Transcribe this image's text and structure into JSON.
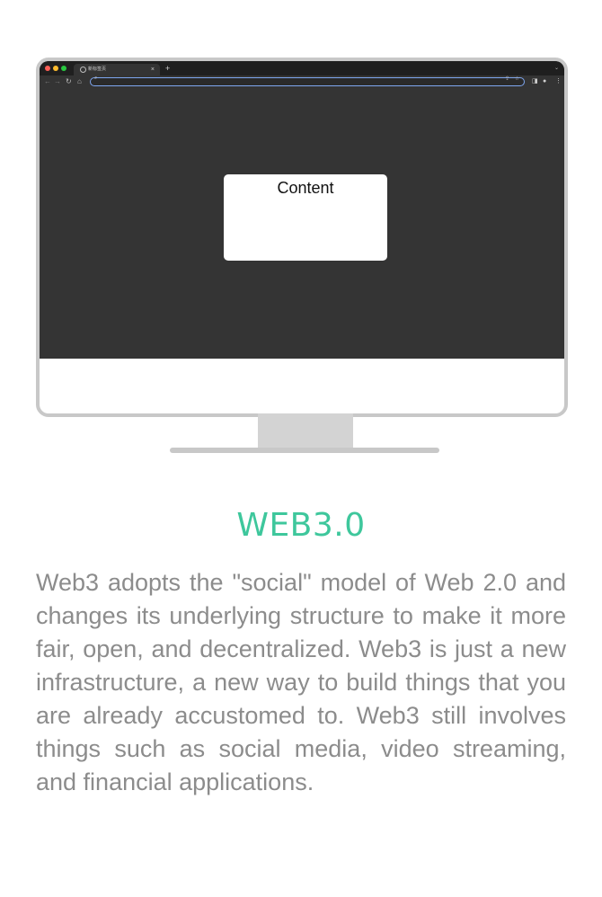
{
  "colors": {
    "accent": "#3ec79c",
    "body_text": "#8c8c8c",
    "screen": "#343434",
    "bezel": "#c8c8c8",
    "dot_red": "#ff5f57",
    "dot_yellow": "#febc2e",
    "dot_green": "#28c840"
  },
  "browser": {
    "tab_title": "新标签页",
    "tab_close": "×",
    "new_tab": "+",
    "tab_menu": "⌄",
    "icons": {
      "back": "arrow-left-icon",
      "forward": "arrow-right-icon",
      "reload": "reload-icon",
      "home": "home-icon",
      "search": "search-icon",
      "share": "share-icon",
      "star": "star-icon",
      "side_panel": "side-panel-icon",
      "profile": "profile-icon",
      "menu": "kebab-menu-icon"
    }
  },
  "card": {
    "label": "Content"
  },
  "section": {
    "title": "WEB3.0",
    "description": "Web3 adopts the \"social\" model of Web 2.0 and changes its underlying structure to make it more fair, open, and decentralized. Web3 is just a new infrastructure, a new way to build things that you are already accustomed to. Web3 still involves things such as social media, video streaming, and financial applications."
  }
}
